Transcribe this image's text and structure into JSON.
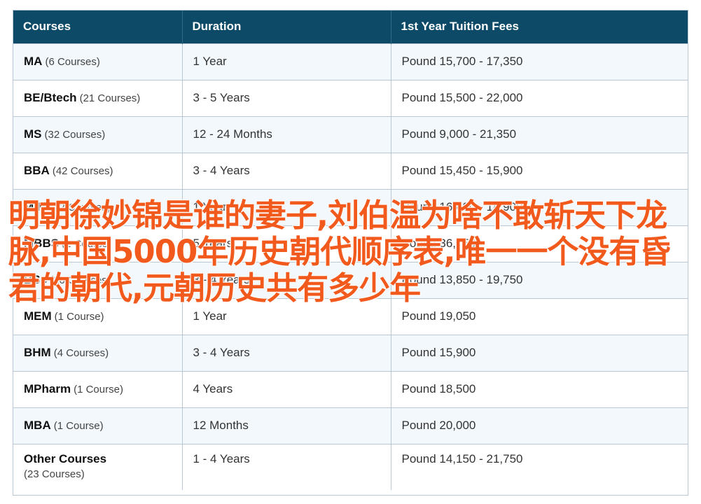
{
  "table": {
    "headers": [
      "Courses",
      "Duration",
      "1st Year Tuition Fees"
    ],
    "rows": [
      {
        "name": "MA",
        "count": "(6 Courses)",
        "duration": "1 Year",
        "fee": "Pound 15,700 - 17,350"
      },
      {
        "name": "BE/Btech",
        "count": "(21 Courses)",
        "duration": "3 - 5 Years",
        "fee": "Pound 15,500 - 22,000"
      },
      {
        "name": "MS",
        "count": "(32 Courses)",
        "duration": "12 - 24 Months",
        "fee": "Pound 9,000 - 21,350"
      },
      {
        "name": "BBA",
        "count": "(42 Courses)",
        "duration": "3 - 4 Years",
        "fee": "Pound 15,450 - 15,900"
      },
      {
        "name": "MIM",
        "count": "(22 Courses)",
        "duration": "1 Year",
        "fee": "Pound 16,400 - 18,900"
      },
      {
        "name": "MBBS",
        "count": "(1 Course)",
        "duration": "5 Years",
        "fee": "Pound 36,750"
      },
      {
        "name": "BSc",
        "count": "(16 Courses)",
        "duration": "3 - 4 Years",
        "fee": "Pound 13,850 - 19,750"
      },
      {
        "name": "MEM",
        "count": "(1 Course)",
        "duration": "1 Year",
        "fee": "Pound 19,050"
      },
      {
        "name": "BHM",
        "count": "(4 Courses)",
        "duration": "3 - 4 Years",
        "fee": "Pound 15,900"
      },
      {
        "name": "MPharm",
        "count": "(1 Course)",
        "duration": "4 Years",
        "fee": "Pound 18,500"
      },
      {
        "name": "MBA",
        "count": "(1 Course)",
        "duration": "12 Months",
        "fee": "Pound 20,000"
      },
      {
        "name": "Other Courses",
        "count": "(23 Courses)",
        "duration": "1 - 4 Years",
        "fee": "Pound 14,150 - 21,750"
      }
    ]
  },
  "overlay_text": "明朝徐妙锦是谁的妻子,刘伯温为啥不敢斩天下龙脉,中国5000年历史朝代顺序表,唯一一个没有昏君的朝代,元朝历史共有多少年",
  "colors": {
    "header_bg": "#0c4a68",
    "alt_row_bg": "#f2f8fc",
    "overlay_text": "#f25a1d"
  }
}
